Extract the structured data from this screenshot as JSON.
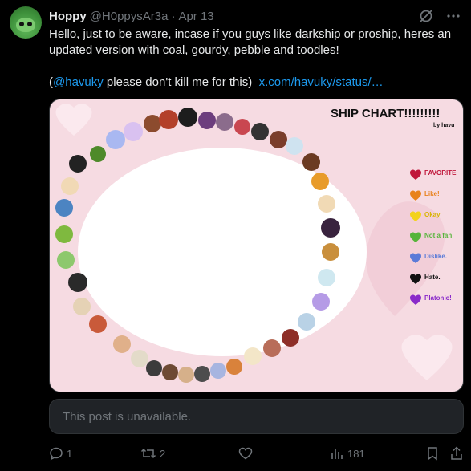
{
  "post": {
    "display_name": "Hoppy",
    "handle": "@H0ppysAr3a",
    "separator": "·",
    "date": "Apr 13",
    "text_line1": "Hello, just to be aware, incase if you guys like darkship or proship, heres an",
    "text_line2": "updated version with coal, gourdy, pebble and toodles!",
    "mention_open": "(",
    "mention": "@havuky",
    "mention_rest": " please don't kill me for this)",
    "link_text": "x.com/havuky/status/…"
  },
  "media": {
    "title": "SHIP CHART!!!!!!!!!",
    "byline": "by havu",
    "legend": [
      {
        "label": "FAVORITE",
        "color": "#c0163a"
      },
      {
        "label": "Like!",
        "color": "#e8821c"
      },
      {
        "label": "Okay",
        "color": "#f3d21b"
      },
      {
        "label": "Not a fan",
        "color": "#56b43a"
      },
      {
        "label": "Dislike.",
        "color": "#5b7bd8"
      },
      {
        "label": "Hate.",
        "color": "#111111"
      },
      {
        "label": "Platonic!",
        "color": "#8a2ac9"
      }
    ]
  },
  "quote": {
    "unavailable_text": "This post is unavailable."
  },
  "actions": {
    "replies": "1",
    "reposts": "2",
    "likes": "",
    "views": "181"
  },
  "colors": {
    "accent": "#1d9bf0",
    "muted": "#71767b",
    "text": "#e7e9ea",
    "bg": "#000000"
  }
}
